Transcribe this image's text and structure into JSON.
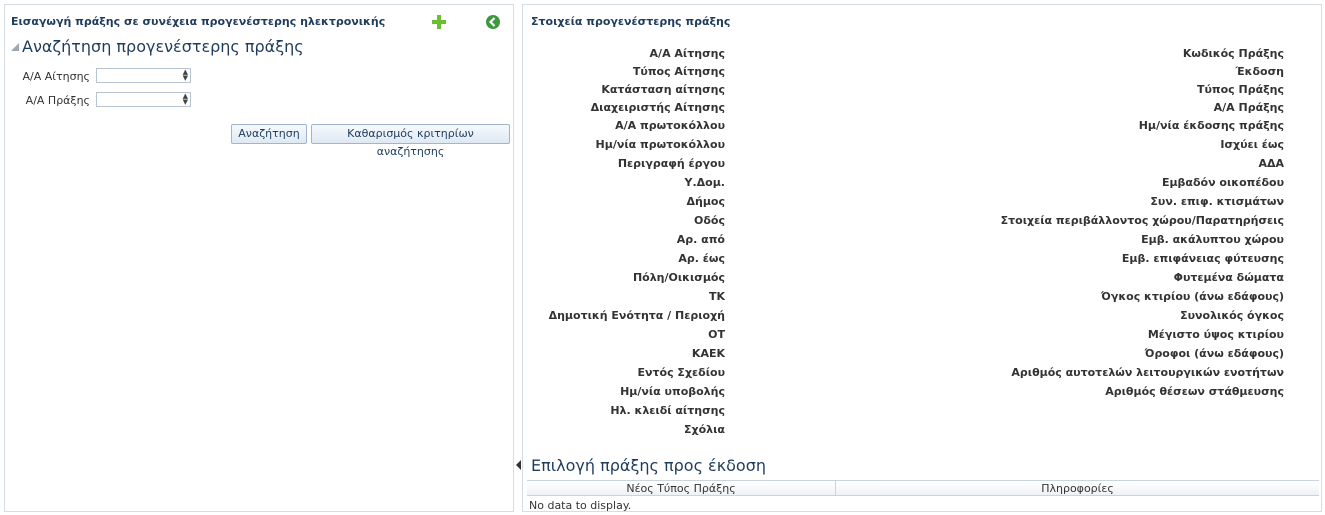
{
  "left": {
    "header": "Εισαγωγή πράξης σε συνέχεια προγενέστερης ηλεκτρονικής",
    "search_title": "Αναζήτηση προγενέστερης πράξης",
    "fields": [
      {
        "label": "Α/Α Αίτησης",
        "value": ""
      },
      {
        "label": "Α/Α Πράξης",
        "value": ""
      }
    ],
    "search_button": "Αναζήτηση",
    "clear_button": "Καθαρισμός κριτηρίων αναζήτησης"
  },
  "right": {
    "header": "Στοιχεία προγενέστερης πράξης",
    "left_labels": [
      "Α/Α Αίτησης",
      "Τύπος Αίτησης",
      "Κατάσταση αίτησης",
      "Διαχειριστής Αίτησης",
      "Α/Α πρωτοκόλλου",
      "Ημ/νία πρωτοκόλλου",
      "Περιγραφή έργου",
      "Υ.Δομ.",
      "Δήμος",
      "Οδός",
      "Αρ. από",
      "Αρ. έως",
      "Πόλη/Οικισμός",
      "ΤΚ",
      "Δημοτική Ενότητα / Περιοχή",
      "ΟΤ",
      "ΚΑΕΚ",
      "Εντός Σχεδίου",
      "Ημ/νία υποβολής",
      "Ηλ. κλειδί αίτησης",
      "Σχόλια"
    ],
    "right_labels": [
      "Κωδικός Πράξης",
      "Έκδοση",
      "Τύπος Πράξης",
      "Α/Α Πράξης",
      "Ημ/νία έκδοσης πράξης",
      "Ισχύει έως",
      "ΑΔΑ",
      "Εμβαδόν οικοπέδου",
      "Συν. επιφ. κτισμάτων",
      "Στοιχεία περιβάλλοντος χώρου/Παρατηρήσεις",
      "Εμβ. ακάλυπτου χώρου",
      "Εμβ. επιφάνειας φύτευσης",
      "Φυτεμένα δώματα",
      "Όγκος κτιρίου (άνω εδάφους)",
      "Συνολικός όγκος",
      "Μέγιστο ύψος κτιρίου",
      "Όροφοι (άνω εδάφους)",
      "Αριθμός αυτοτελών λειτουργικών ενοτήτων",
      "Αριθμός θέσεων στάθμευσης"
    ],
    "select_title": "Επιλογή πράξης προς έκδοση",
    "table": {
      "columns": [
        "Νέος Τύπος Πράξης",
        "Πληροφορίες"
      ],
      "empty_text": "No data to display."
    }
  },
  "colors": {
    "accent": "#1f3c5c",
    "add_green": "#6abf2e",
    "back_green": "#3c9a3c"
  }
}
